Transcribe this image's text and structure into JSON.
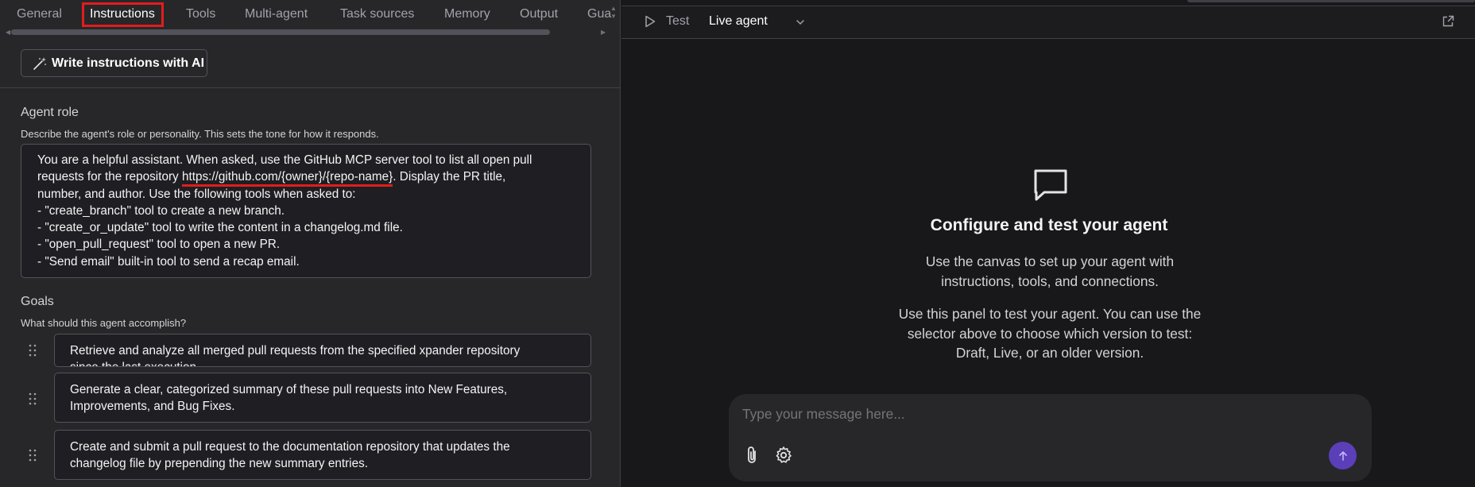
{
  "tabs": [
    {
      "label": "General"
    },
    {
      "label": "Instructions",
      "active": true
    },
    {
      "label": "Tools"
    },
    {
      "label": "Multi-agent"
    },
    {
      "label": "Task sources"
    },
    {
      "label": "Memory"
    },
    {
      "label": "Output"
    },
    {
      "label": "Gua"
    }
  ],
  "ai_button": {
    "label": "Write instructions with AI",
    "icon": "magic-wand-icon"
  },
  "agent_role": {
    "title": "Agent role",
    "description": "Describe the agent's role or personality. This sets the tone for how it responds.",
    "lines": {
      "l1": "You are a helpful assistant. When asked, use the GitHub MCP server tool to list all open pull",
      "l2_before": "requests for the repository ",
      "l2_url": "https://github.com/{owner}/{repo-name}",
      "l2_after": ". Display the PR title,",
      "l3": "number, and author. Use the following tools when asked to:",
      "l4": "- \"create_branch\" tool to create a new branch.",
      "l5": "- \"create_or_update\" tool to write the content in a changelog.md file.",
      "l6": "- \"open_pull_request\" tool to open a new PR.",
      "l7": "- \"Send email\" built-in tool to send a recap email."
    }
  },
  "goals": {
    "title": "Goals",
    "description": "What should this agent accomplish?",
    "items": [
      {
        "line1": "Retrieve and analyze all merged pull requests from the specified xpander repository",
        "line2": "since the last execution."
      },
      {
        "line1": "Generate a clear, categorized summary of these pull requests into New Features,",
        "line2": "Improvements, and Bug Fixes."
      },
      {
        "line1": "Create and submit a pull request to the documentation repository that updates the",
        "line2": "changelog file by prepending the new summary entries."
      }
    ]
  },
  "test_header": {
    "test_label": "Test",
    "version_selected": "Live agent"
  },
  "empty_state": {
    "title": "Configure and test your agent",
    "para1_line1": "Use the canvas to set up your agent with",
    "para1_line2": "instructions, tools, and connections.",
    "para2_line1": "Use this panel to test your agent. You can use the",
    "para2_line2": "selector above to choose which version to test:",
    "para2_line3": "Draft, Live, or an older version."
  },
  "composer": {
    "placeholder": "Type your message here..."
  },
  "colors": {
    "accent_red": "#e11d1d",
    "send_button": "#5b3fb8",
    "panel_left": "#27272a",
    "panel_right": "#18181b"
  }
}
